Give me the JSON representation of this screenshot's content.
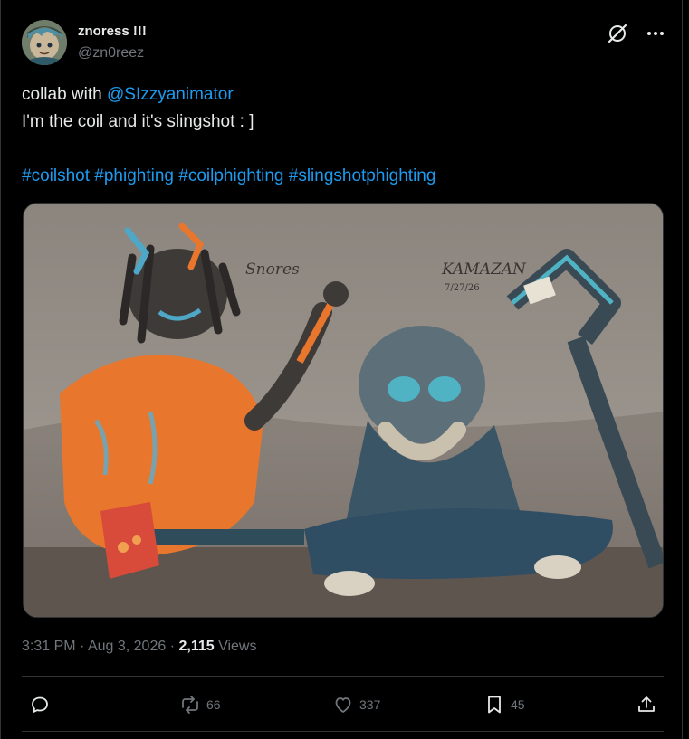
{
  "post": {
    "author": {
      "display_name": "znoress !!!",
      "handle": "@zn0reez"
    },
    "text": {
      "line1_prefix": "collab with ",
      "mention": "@SIzzyanimator",
      "line2": "I'm the coil and it's slingshot : ]",
      "hashtags": [
        "#coilshot",
        "#phighting",
        "#coilphighting",
        "#slingshotphighting"
      ]
    },
    "media": {
      "signature_left": "Snores",
      "signature_right": "KAMAZAN",
      "signature_date": "7/27/26"
    },
    "meta": {
      "time": "3:31 PM",
      "separator": "·",
      "date": "Aug 3, 2026",
      "views_count": "2,115",
      "views_label": "Views"
    },
    "actions": {
      "reply": {
        "icon": "reply-icon",
        "count": ""
      },
      "repost": {
        "icon": "repost-icon",
        "count": "66"
      },
      "like": {
        "icon": "heart-icon",
        "count": "337"
      },
      "bookmark": {
        "icon": "bookmark-icon",
        "count": "45"
      },
      "share": {
        "icon": "share-icon",
        "count": ""
      }
    }
  },
  "colors": {
    "background": "#000000",
    "text": "#e7e9ea",
    "secondary": "#71767b",
    "link": "#1d9bf0",
    "border": "#2f3336"
  }
}
